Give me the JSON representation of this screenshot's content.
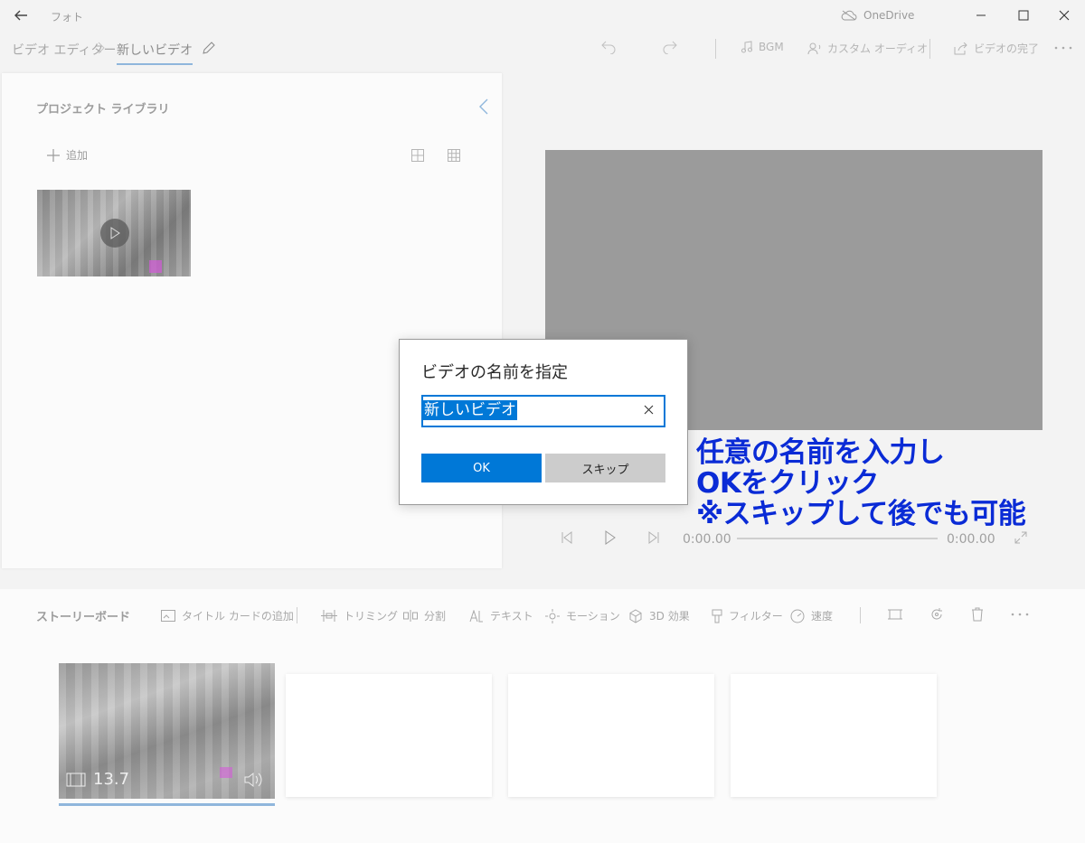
{
  "app": {
    "title": "フォト",
    "onedrive_label": "OneDrive"
  },
  "breadcrumb": {
    "parent": "ビデオ エディター",
    "current": "新しいビデオ"
  },
  "toolbar": {
    "bgm": "BGM",
    "custom_audio": "カスタム オーディオ",
    "finish_video": "ビデオの完了"
  },
  "library": {
    "title": "プロジェクト ライブラリ",
    "add": "追加"
  },
  "playback": {
    "current_time": "0:00.00",
    "total_time": "0:00.00"
  },
  "storyboard": {
    "title": "ストーリーボード",
    "tools": [
      {
        "label": "タイトル カードの追加",
        "icon": "title-card-icon"
      },
      {
        "label": "トリミング",
        "icon": "trim-icon"
      },
      {
        "label": "分割",
        "icon": "split-icon"
      },
      {
        "label": "テキスト",
        "icon": "text-icon"
      },
      {
        "label": "モーション",
        "icon": "motion-icon"
      },
      {
        "label": "3D 効果",
        "icon": "3d-effects-icon"
      },
      {
        "label": "フィルター",
        "icon": "filter-icon"
      },
      {
        "label": "速度",
        "icon": "speed-icon"
      }
    ],
    "clip_duration": "13.7"
  },
  "dialog": {
    "title": "ビデオの名前を指定",
    "input_value": "新しいビデオ",
    "ok": "OK",
    "skip": "スキップ"
  },
  "annotation": {
    "line1": "任意の名前を入力し",
    "line2": "OKをクリック",
    "line3": "※スキップして後でも可能"
  },
  "colors": {
    "accent": "#0078d7",
    "annotation": "#0a2bd6",
    "preview_bg": "#9b9b9b"
  }
}
